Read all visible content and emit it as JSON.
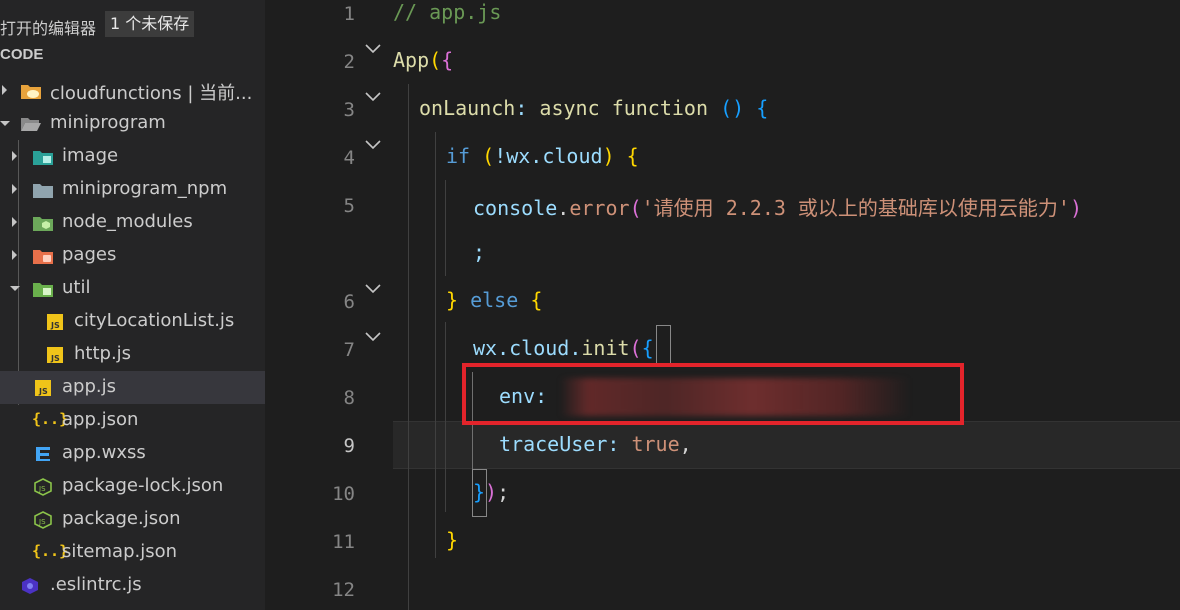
{
  "sidebar": {
    "open_editors_label": "打开的编辑器",
    "unsaved_badge": "1 个未保存",
    "section_title": "CODE",
    "items": [
      {
        "label": "cloudfunctions | 当前...",
        "icon": "cloud-folder-icon",
        "twisty": "closed"
      },
      {
        "label": "miniprogram",
        "icon": "folder-open-icon",
        "twisty": "open"
      },
      {
        "label": "image",
        "icon": "image-folder-icon",
        "twisty": "closed"
      },
      {
        "label": "miniprogram_npm",
        "icon": "folder-icon",
        "twisty": "closed"
      },
      {
        "label": "node_modules",
        "icon": "node-folder-icon",
        "twisty": "closed"
      },
      {
        "label": "pages",
        "icon": "pages-folder-icon",
        "twisty": "closed"
      },
      {
        "label": "util",
        "icon": "util-folder-icon",
        "twisty": "open"
      },
      {
        "label": "cityLocationList.js",
        "icon": "js-file-icon"
      },
      {
        "label": "http.js",
        "icon": "js-file-icon"
      },
      {
        "label": "app.js",
        "icon": "js-file-icon",
        "active": true
      },
      {
        "label": "app.json",
        "icon": "json-file-icon"
      },
      {
        "label": "app.wxss",
        "icon": "css-file-icon"
      },
      {
        "label": "package-lock.json",
        "icon": "node-json-file-icon"
      },
      {
        "label": "package.json",
        "icon": "node-json-file-icon"
      },
      {
        "label": "sitemap.json",
        "icon": "json-file-icon"
      },
      {
        "label": ".eslintrc.js",
        "icon": "eslint-file-icon"
      }
    ]
  },
  "editor": {
    "current_line": "9",
    "line_numbers": [
      "1",
      "2",
      "3",
      "4",
      "5",
      "6",
      "7",
      "8",
      "9",
      "10",
      "11",
      "12"
    ],
    "code": {
      "l1": "// app.js",
      "l2_func": "App",
      "l2_paren": "(",
      "l2_brace": "{",
      "l3_prop": "onLaunch",
      "l3_colon": ": ",
      "l3_async": "async",
      "l3_function": "function",
      "l3_parens": "()",
      "l3_brace": "{",
      "l4_if": "if",
      "l4_paren_open": "(",
      "l4_expr": "!wx.cloud",
      "l4_paren_close": ")",
      "l4_brace": "{",
      "l5_console": "console",
      "l5_dot": ".",
      "l5_error": "error",
      "l5_paren_open": "(",
      "l5_string": "'请使用 2.2.3 或以上的基础库以使用云能力'",
      "l5_paren_close": ")",
      "l5b_semicolon": ";",
      "l6_brace_close": "}",
      "l6_else": "else",
      "l6_brace_open": "{",
      "l7_obj": "wx.cloud.",
      "l7_init": "init",
      "l7_paren": "(",
      "l7_brace": "{",
      "l8_env": "env",
      "l8_colon": ":",
      "l9_trace": "traceUser",
      "l9_colon": ": ",
      "l9_true": "true",
      "l9_comma": ",",
      "l10_brace": "}",
      "l10_paren": ")",
      "l10_semi": ";",
      "l11_brace": "}"
    }
  },
  "colors": {
    "highlight_box": "#e3242b",
    "string": "#ce9178",
    "keyword": "#569cd6"
  }
}
